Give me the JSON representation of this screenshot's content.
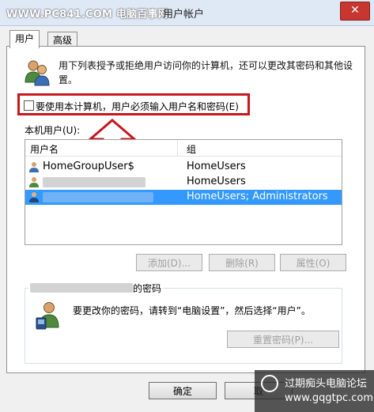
{
  "watermark": {
    "site": "WWW.PC841.COM 电脑百事网"
  },
  "window": {
    "title": "用户帐户",
    "close_glyph": "✕"
  },
  "tabs": [
    {
      "label": "用户",
      "active": true
    },
    {
      "label": "高级",
      "active": false
    }
  ],
  "description": "用下列表授予或拒绝用户访问你的计算机，还可以更改其密码和其他设置。",
  "require_login": {
    "label": "要使用本计算机，用户必须输入用户名和密码(E)",
    "checked": false
  },
  "local_users_label": "本机用户(U):",
  "users_table": {
    "columns": [
      "用户名",
      "组"
    ],
    "rows": [
      {
        "name": "HomeGroupUser$",
        "group": "HomeUsers",
        "selected": false
      },
      {
        "name": "",
        "group": "HomeUsers",
        "selected": false
      },
      {
        "name": "",
        "group": "HomeUsers; Administrators",
        "selected": true
      }
    ]
  },
  "list_buttons": {
    "add": "添加(D)...",
    "remove": "删除(R)",
    "properties": "属性(O)"
  },
  "password_group": {
    "title_suffix": "的密码",
    "info": "要更改你的密码，请转到“电脑设置”，然后选择“用户”。",
    "reset_button": "重置密码(P)..."
  },
  "dialog_buttons": {
    "ok": "确定",
    "cancel": "取"
  },
  "bottom_watermark": {
    "line1": "过期痴头电脑论坛",
    "line2": "www.gqgtpc.com"
  },
  "colors": {
    "highlight": "#3399ff",
    "annotation_red": "#c8161d",
    "close_red": "#c7372f"
  },
  "icons": [
    "users-icon",
    "user-icon",
    "arrow-up-annotation",
    "key-user-icon",
    "forum-logo-icon"
  ]
}
